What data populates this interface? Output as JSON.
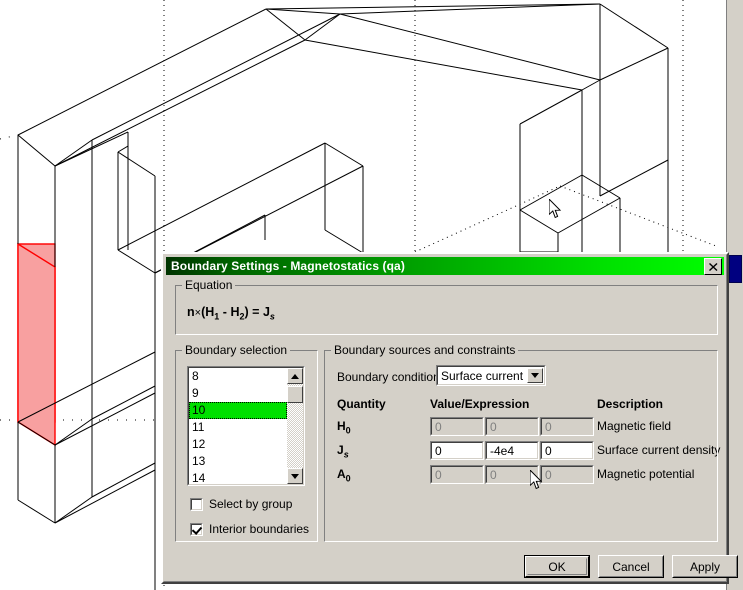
{
  "window": {
    "title": "Boundary Settings - Magnetostatics (qa)",
    "close_label": "✕"
  },
  "equation": {
    "group_label": "Equation",
    "text_parts": {
      "n": "n",
      "times": "×",
      "open": "(",
      "H": "H",
      "sub1": "1",
      "minus": "-",
      "sub2": "2",
      "close": ")",
      "equals": "=",
      "J": "J",
      "subs": "s"
    }
  },
  "boundary_selection": {
    "group_label": "Boundary selection",
    "items": [
      {
        "label": "8",
        "selected": false
      },
      {
        "label": "9",
        "selected": false
      },
      {
        "label": "10",
        "selected": true
      },
      {
        "label": "11",
        "selected": false
      },
      {
        "label": "12",
        "selected": false
      },
      {
        "label": "13",
        "selected": false
      },
      {
        "label": "14",
        "selected": false
      }
    ],
    "select_by_group": {
      "label_pre": "Select by ",
      "label_mnemonic": "g",
      "label_post": "roup",
      "checked": false
    },
    "interior_boundaries": {
      "label": "Interior boundaries",
      "checked": true
    }
  },
  "sources": {
    "group_label": "Boundary sources and constraints",
    "condition_label": "Boundary condition:",
    "condition_value": "Surface current",
    "condition_options": [
      "Surface current"
    ],
    "headers": {
      "quantity": "Quantity",
      "value": "Value/Expression",
      "description": "Description"
    },
    "rows": [
      {
        "symbol": "H",
        "subscript": "0",
        "sub_italic": false,
        "values": [
          "0",
          "0",
          "0"
        ],
        "enabled": false,
        "description": "Magnetic field"
      },
      {
        "symbol": "J",
        "subscript": "s",
        "sub_italic": true,
        "values": [
          "0",
          "-4e4",
          "0"
        ],
        "enabled": true,
        "description": "Surface current density"
      },
      {
        "symbol": "A",
        "subscript": "0",
        "sub_italic": false,
        "values": [
          "0",
          "0",
          "0"
        ],
        "enabled": false,
        "description": "Magnetic potential"
      }
    ]
  },
  "buttons": {
    "ok": "OK",
    "cancel": "Cancel",
    "apply": "Apply"
  },
  "colors": {
    "title_gradient_start": "#003300",
    "title_gradient_end": "#00ff00",
    "selection_green": "#00e000",
    "face_highlight_fill": "#f8a0a0",
    "face_highlight_stroke": "#ff0000",
    "dialog_face": "#d4d0c8",
    "scroll_thumb": "#000080"
  },
  "graphics": {
    "description": "3D wireframe C-core geometry with highlighted boundary face",
    "highlighted_face": "boundary 10"
  }
}
